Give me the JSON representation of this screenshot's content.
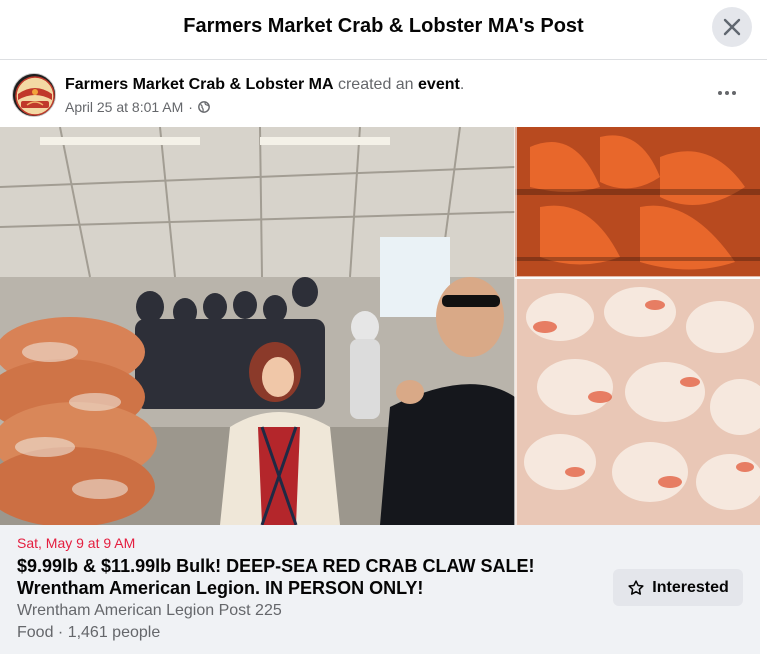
{
  "modal": {
    "title": "Farmers Market Crab & Lobster MA's Post"
  },
  "post": {
    "author": "Farmers Market Crab & Lobster MA",
    "action": "created an",
    "object": "event",
    "period": ".",
    "timestamp": "April 25 at 8:01 AM",
    "separator": "·",
    "audience_icon": "globe-icon",
    "avatar_text_top": "FARMERS MARKET",
    "avatar_text_bottom": "LOBSTER"
  },
  "event": {
    "date": "Sat, May 9 at 9 AM",
    "title": "$9.99lb & $11.99lb Bulk! DEEP-SEA RED CRAB CLAW SALE! Wrentham American Legion. IN PERSON ONLY!",
    "venue": "Wrentham American Legion Post 225",
    "stats": "Food · 1,461 people",
    "interested_label": "Interested",
    "interested_icon": "star-icon"
  },
  "colors": {
    "date_red": "#e41e3f",
    "secondary_text": "#65676b",
    "button_gray": "#e4e6eb",
    "card_bg": "#f0f2f5"
  }
}
